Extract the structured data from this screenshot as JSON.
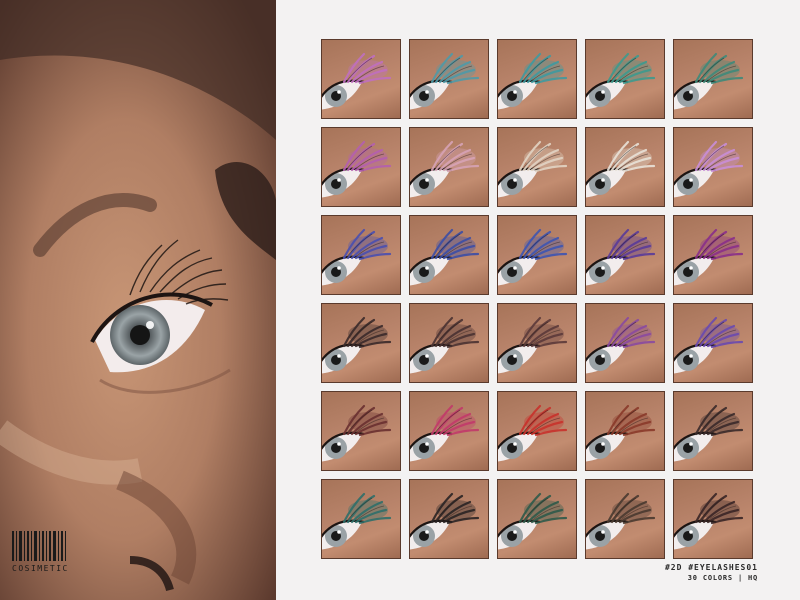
{
  "brand": {
    "logo_text": "COSIMETIC"
  },
  "product": {
    "title": "#2D #EYELASHES01",
    "subtitle": "30 COLORS | HQ"
  },
  "swatches": [
    {
      "color": "#c06fc0"
    },
    {
      "color": "#4f9aa8"
    },
    {
      "color": "#3f9aa0"
    },
    {
      "color": "#3e9a8e"
    },
    {
      "color": "#3f8a7a"
    },
    {
      "color": "#b45fb0"
    },
    {
      "color": "#d7a3b6"
    },
    {
      "color": "#e2d4c4"
    },
    {
      "color": "#e9e2d8"
    },
    {
      "color": "#c98ed8"
    },
    {
      "color": "#4a4fb0"
    },
    {
      "color": "#3c4ea6"
    },
    {
      "color": "#3e55b2"
    },
    {
      "color": "#5a3b9a"
    },
    {
      "color": "#8a2f8a"
    },
    {
      "color": "#3a2a2a"
    },
    {
      "color": "#4a3232"
    },
    {
      "color": "#5c3a3a"
    },
    {
      "color": "#8a4aa0"
    },
    {
      "color": "#6a4ab0"
    },
    {
      "color": "#6a3030"
    },
    {
      "color": "#c23a6a"
    },
    {
      "color": "#c8322c"
    },
    {
      "color": "#8a3a2a"
    },
    {
      "color": "#3a2a2a"
    },
    {
      "color": "#2f6f6a"
    },
    {
      "color": "#2a2424"
    },
    {
      "color": "#2f5a4a"
    },
    {
      "color": "#4a3a30"
    },
    {
      "color": "#3a2626"
    }
  ]
}
